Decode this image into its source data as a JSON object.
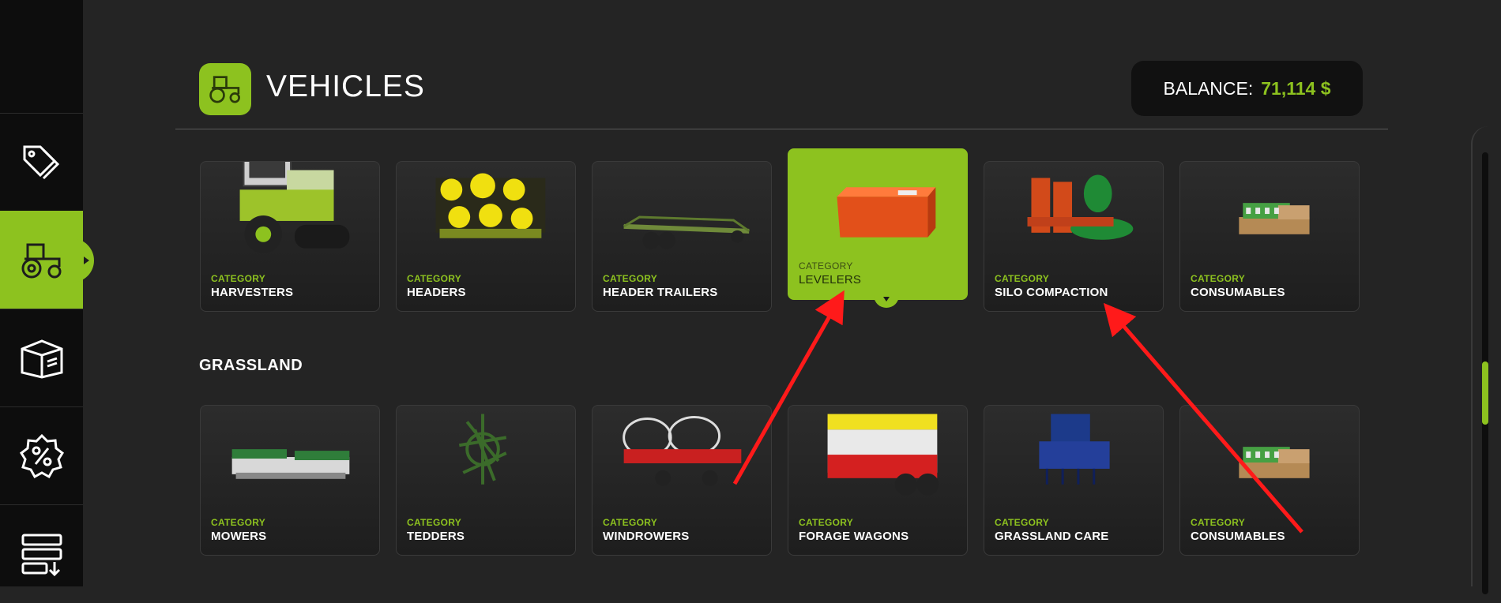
{
  "header": {
    "title": "VEHICLES",
    "icon": "tractor-icon"
  },
  "balance": {
    "label": "BALANCE:",
    "value": "71,114 $"
  },
  "sidebar": {
    "items": [
      {
        "icon": "price-tags-icon",
        "active": false
      },
      {
        "icon": "tractor-icon",
        "active": true
      },
      {
        "icon": "box-icon",
        "active": false
      },
      {
        "icon": "percent-badge-icon",
        "active": false
      },
      {
        "icon": "list-download-icon",
        "active": false
      }
    ]
  },
  "row1": [
    {
      "category": "CATEGORY",
      "name": "HARVESTERS"
    },
    {
      "category": "CATEGORY",
      "name": "HEADERS"
    },
    {
      "category": "CATEGORY",
      "name": "HEADER TRAILERS"
    },
    {
      "category": "CATEGORY",
      "name": "LEVELERS",
      "selected": true
    },
    {
      "category": "CATEGORY",
      "name": "SILO COMPACTION"
    },
    {
      "category": "CATEGORY",
      "name": "CONSUMABLES"
    }
  ],
  "grassland": {
    "title": "GRASSLAND",
    "items": [
      {
        "category": "CATEGORY",
        "name": "MOWERS"
      },
      {
        "category": "CATEGORY",
        "name": "TEDDERS"
      },
      {
        "category": "CATEGORY",
        "name": "WINDROWERS"
      },
      {
        "category": "CATEGORY",
        "name": "FORAGE WAGONS"
      },
      {
        "category": "CATEGORY",
        "name": "GRASSLAND CARE"
      },
      {
        "category": "CATEGORY",
        "name": "CONSUMABLES"
      }
    ]
  },
  "colors": {
    "accent": "#8dc21f",
    "background": "#242424",
    "sidebar": "#0d0d0d",
    "arrow": "#ff1a1a"
  }
}
